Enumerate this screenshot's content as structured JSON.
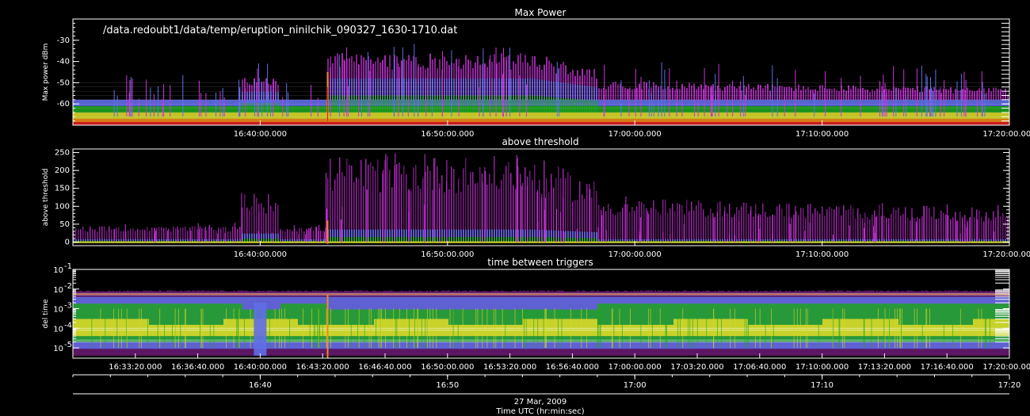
{
  "file_label": "/data.redoubt1/data/temp/eruption_ninilchik_090327_1630-1710.dat",
  "footer": {
    "date": "27 Mar, 2009",
    "axis_title": "Time UTC (hr:min:sec)"
  },
  "colors": {
    "background": "#000000",
    "axes": "#ffffff",
    "magenta": "#cc33dd",
    "blue": "#5f6ee6",
    "green": "#1ea31e",
    "yellow": "#d8d82a",
    "orange": "#f08a1c",
    "red": "#e02020"
  },
  "chart_data": [
    {
      "type": "scatter",
      "title": "Max Power",
      "ylabel": "Max power dBm",
      "xlabel": "",
      "x_range": [
        "16:30:00",
        "17:20:00"
      ],
      "ylim": [
        -70,
        -20
      ],
      "yticks": [
        "-30",
        "-40",
        "-50",
        "-60"
      ],
      "xtick_labels": [
        "16:40:00.000",
        "16:50:00.000",
        "17:00:00.000",
        "17:10:00.000",
        "17:20:00.000"
      ],
      "description_series": [
        {
          "name": "",
          "x": [
            "16:33",
            "16:38",
            "16:40",
            "16:44",
            "16:48",
            "16:52",
            "16:56",
            "17:00",
            "17:05",
            "17:10",
            "17:15",
            "17:19"
          ],
          "values": [
            -62,
            -58,
            -55,
            -40,
            -38,
            -40,
            -43,
            -48,
            -51,
            -50,
            -52,
            -53
          ]
        }
      ]
    },
    {
      "type": "scatter",
      "title": "above threshold",
      "ylabel": "above threshold",
      "xlabel": "",
      "x_range": [
        "16:30:00",
        "17:20:00"
      ],
      "ylim": [
        -10,
        260
      ],
      "yticks": [
        "250",
        "200",
        "150",
        "100",
        "50",
        "0"
      ],
      "xtick_labels": [
        "16:40:00.000",
        "16:50:00.000",
        "17:00:00.000",
        "17:10:00.000",
        "17:20:00.000"
      ],
      "description_series": [
        {
          "name": "",
          "x": [
            "16:33",
            "16:38",
            "16:40",
            "16:44",
            "16:48",
            "16:52",
            "16:56",
            "17:00",
            "17:05",
            "17:10",
            "17:15",
            "17:19"
          ],
          "values": [
            20,
            30,
            120,
            250,
            250,
            240,
            200,
            160,
            120,
            150,
            90,
            70
          ]
        }
      ]
    },
    {
      "type": "scatter",
      "title": "time between triggers",
      "ylabel": "del time",
      "xlabel": "Time UTC (hr:min:sec)",
      "x_range": [
        "16:30:00",
        "17:20:00"
      ],
      "ylim": [
        3e-06,
        0.1
      ],
      "yscale": "log",
      "yticks": [
        "10^-1",
        "10^-2",
        "10^-3",
        "10^-4",
        "10^-5",
        "10^-6"
      ],
      "xtick_labels": [
        "16:33:20.000",
        "16:36:40.000",
        "16:40:00.000",
        "16:43:20.000",
        "16:46:40.000",
        "16:50:00.000",
        "16:53:20.000",
        "16:56:40.000",
        "17:00:00.000",
        "17:03:20.000",
        "17:06:40.000",
        "17:10:00.000",
        "17:13:20.000",
        "17:16:40.000",
        "17:20:00.000"
      ],
      "secondary_xtick_labels": [
        "16:40",
        "16:50",
        "17:00",
        "17:10",
        "17:20"
      ]
    }
  ]
}
